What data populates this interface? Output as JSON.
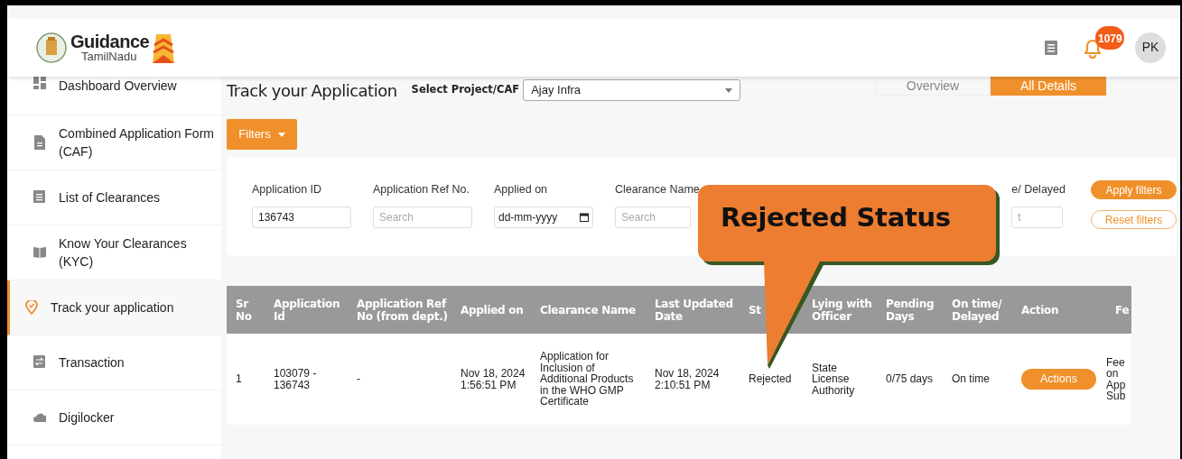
{
  "header": {
    "logo": {
      "title": "Guidance",
      "subtitle": "TamilNadu"
    },
    "notification_count": "1079",
    "avatar": "PK"
  },
  "sidebar": {
    "items": [
      {
        "label": "Dashboard Overview",
        "selected": false
      },
      {
        "label": "Combined Application Form (CAF)",
        "selected": false
      },
      {
        "label": "List of Clearances",
        "selected": false
      },
      {
        "label": "Know Your Clearances (KYC)",
        "selected": false
      },
      {
        "label": "Track your application",
        "selected": true
      },
      {
        "label": "Transaction",
        "selected": false
      },
      {
        "label": "Digilocker",
        "selected": false
      }
    ]
  },
  "page": {
    "title": "Track your Application",
    "project_label": "Select Project/CAF",
    "project_value": "Ajay Infra"
  },
  "view_tabs": [
    {
      "label": "Overview",
      "selected": false
    },
    {
      "label": "All Details",
      "selected": true
    }
  ],
  "filters_button": "Filters",
  "filters": {
    "fields": [
      {
        "label": "Application ID",
        "kind": "text",
        "value": "136743"
      },
      {
        "label": "Application Ref No.",
        "kind": "text",
        "placeholder": "Search"
      },
      {
        "label": "Applied on",
        "kind": "date",
        "placeholder": "dd-mm-yyyy"
      },
      {
        "label": "Clearance Name",
        "kind": "text",
        "placeholder": "Search"
      },
      {
        "label": "e/ Delayed",
        "kind": "text",
        "placeholder": "t"
      }
    ],
    "apply": "Apply filters",
    "reset": "Reset filters"
  },
  "table": {
    "columns": [
      "Sr No",
      "Application Id",
      "Application Ref No (from dept.)",
      "Applied on",
      "Clearance Name",
      "Last Updated Date",
      "St",
      "Lying with Officer",
      "Pending Days",
      "On time/ Delayed",
      "Action",
      "Fe"
    ],
    "rows": [
      {
        "cells": [
          "1",
          "103079 - 136743",
          "-",
          "Nov 18, 2024 1:56:51 PM",
          "Application for Inclusion of Additional Products in the WHO GMP Certificate",
          "Nov 18, 2024 2:10:51 PM",
          "Rejected",
          "State License Authority",
          "0/75 days",
          "On time",
          "Actions",
          "Fee on App Sub"
        ]
      }
    ]
  },
  "callout": "Rejected Status"
}
